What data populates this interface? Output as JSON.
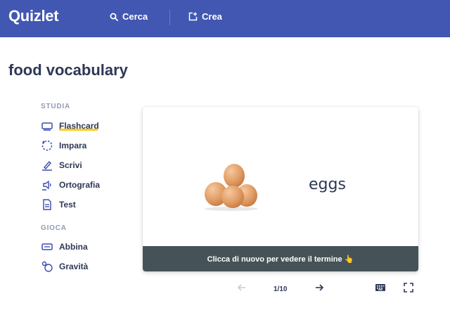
{
  "header": {
    "logo": "Quizlet",
    "search_label": "Cerca",
    "create_label": "Crea"
  },
  "set_title": "food vocabulary",
  "study": {
    "section_label": "STUDIA",
    "modes": [
      {
        "label": "Flashcard",
        "icon": "flashcard-icon",
        "active": true
      },
      {
        "label": "Impara",
        "icon": "learn-icon"
      },
      {
        "label": "Scrivi",
        "icon": "write-icon"
      },
      {
        "label": "Ortografia",
        "icon": "spell-icon"
      },
      {
        "label": "Test",
        "icon": "test-icon"
      }
    ]
  },
  "play": {
    "section_label": "GIOCA",
    "modes": [
      {
        "label": "Abbina",
        "icon": "match-icon"
      },
      {
        "label": "Gravità",
        "icon": "gravity-icon"
      }
    ]
  },
  "card": {
    "term": "eggs",
    "image": "eggs-image",
    "footer_text": "Clicca di nuovo per vedere il termine 👆"
  },
  "controls": {
    "counter": "1/10"
  },
  "colors": {
    "header_bg": "#4257b2",
    "accent_underline": "#ffcd1f",
    "card_footer_bg": "#455358"
  }
}
